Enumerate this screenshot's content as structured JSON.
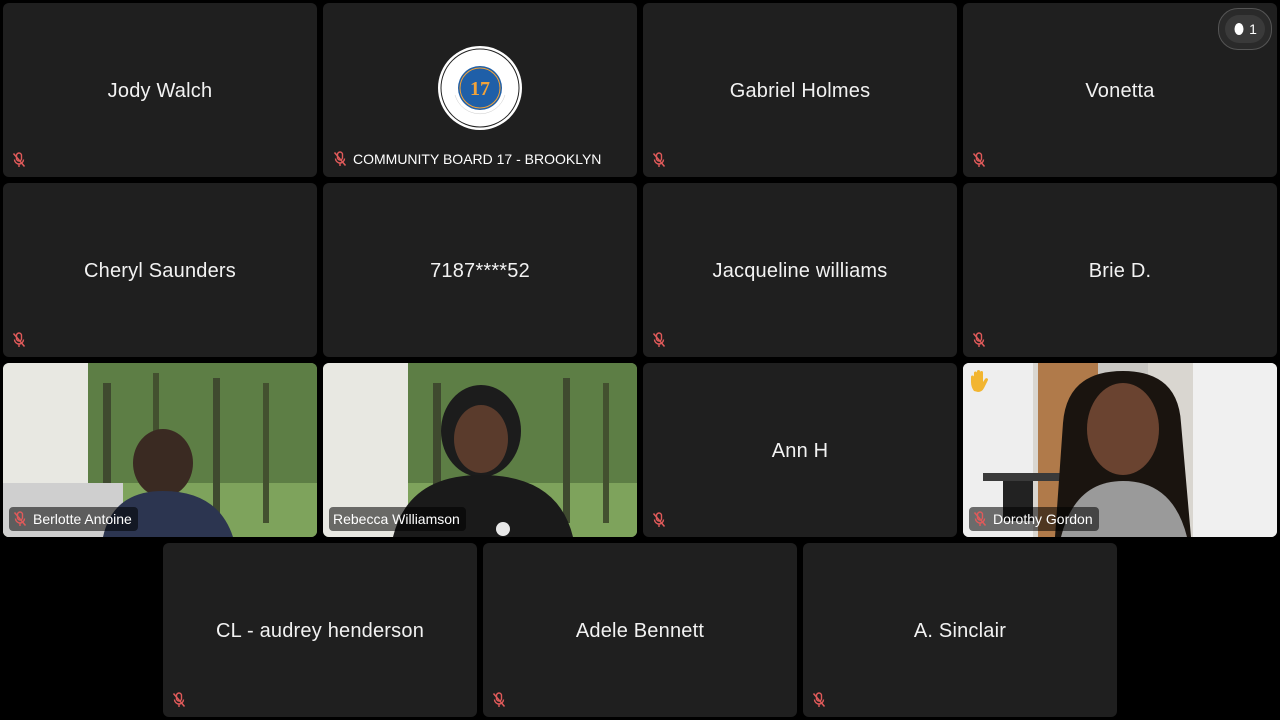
{
  "participant_count": "1",
  "tiles": {
    "jody": {
      "name": "Jody Walch"
    },
    "cb17": {
      "name": "COMMUNITY BOARD 17 - BROOKLYN"
    },
    "gabriel": {
      "name": "Gabriel Holmes"
    },
    "vonetta": {
      "name": "Vonetta"
    },
    "cheryl": {
      "name": "Cheryl Saunders"
    },
    "phone": {
      "name": "7187****52"
    },
    "jacqueline": {
      "name": "Jacqueline williams"
    },
    "brie": {
      "name": "Brie D."
    },
    "berlotte": {
      "name": "Berlotte Antoine"
    },
    "rebecca": {
      "name": "Rebecca Williamson"
    },
    "ann": {
      "name": "Ann H"
    },
    "dorothy": {
      "name": "Dorothy Gordon"
    },
    "audrey": {
      "name": "CL - audrey henderson"
    },
    "adele": {
      "name": "Adele Bennett"
    },
    "sinclair": {
      "name": "A. Sinclair"
    }
  },
  "colors": {
    "tile_bg": "#1f1f1f",
    "mute_red": "#e05a5a",
    "background": "#000000"
  }
}
